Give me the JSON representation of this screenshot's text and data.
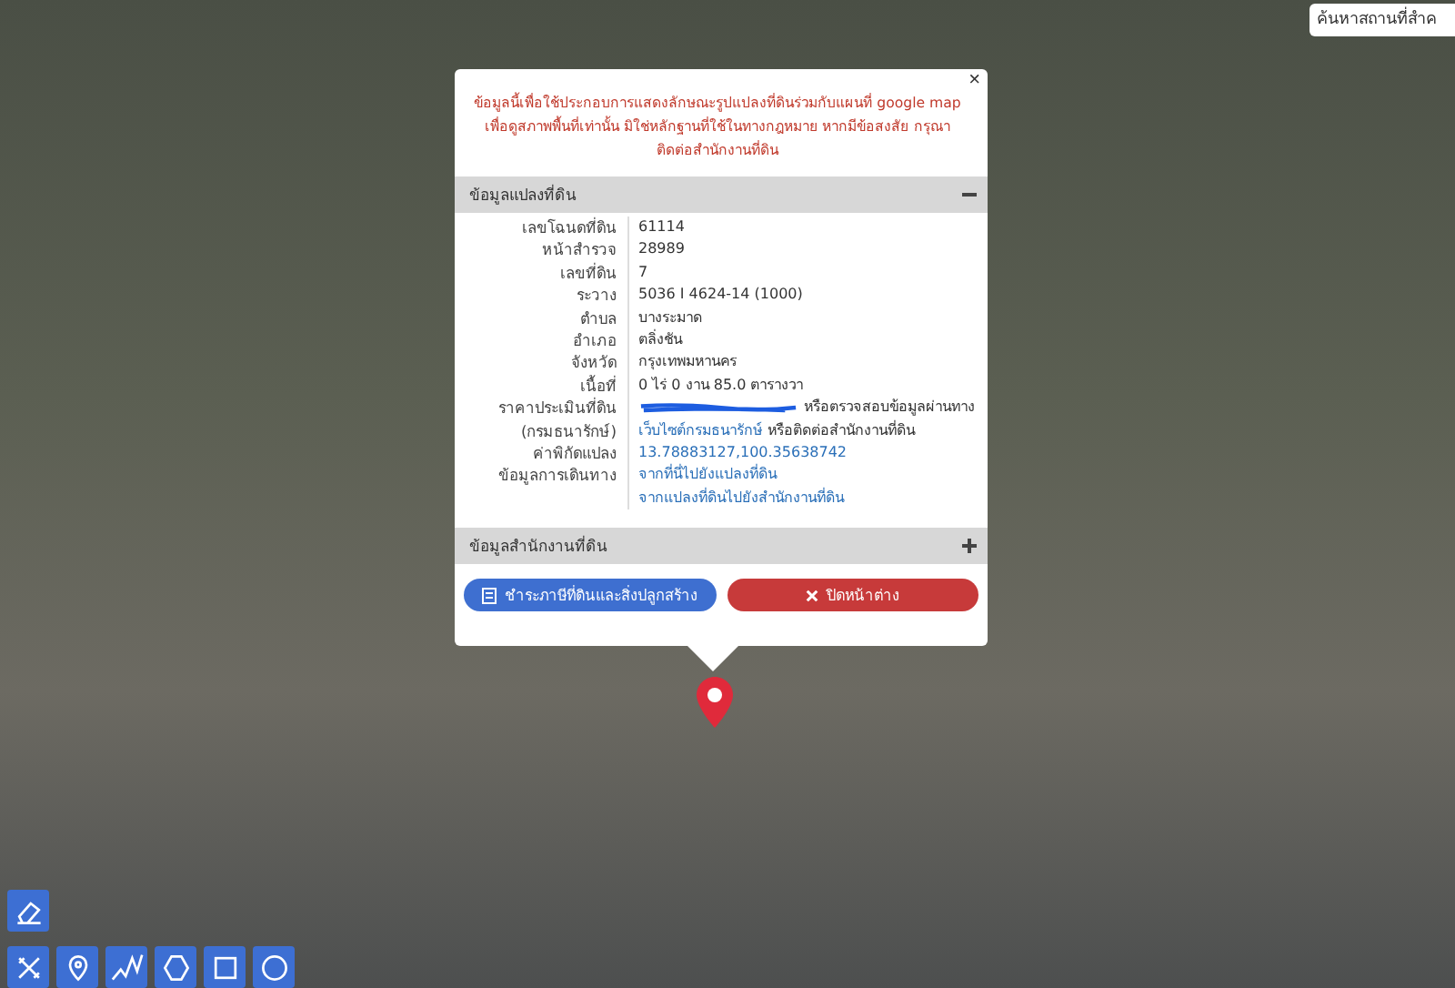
{
  "search": {
    "placeholder": "ค้นหาสถานที่สำค"
  },
  "popup": {
    "close": "×",
    "notice": "ข้อมูลนี้เพื่อใช้ประกอบการแสดงลักษณะรูปแปลงที่ดินร่วมกับแผนที่ google map เพื่อดูสภาพพื้นที่เท่านั้น มิใช่หลักฐานที่ใช้ในทางกฎหมาย หากมีข้อสงสัย กรุณาติดต่อสำนักงานที่ดิน",
    "sections": [
      {
        "title": "ข้อมูลแปลงที่ดิน",
        "expanded": true,
        "rows": [
          {
            "label": "เลขโฉนดที่ดิน",
            "parts": [
              {
                "kind": "text",
                "text": "61114"
              }
            ]
          },
          {
            "label": "หน้าสำรวจ",
            "parts": [
              {
                "kind": "text",
                "text": "28989"
              }
            ]
          },
          {
            "label": "เลขที่ดิน",
            "parts": [
              {
                "kind": "text",
                "text": "7"
              }
            ]
          },
          {
            "label": "ระวาง",
            "parts": [
              {
                "kind": "text",
                "text": "5036 I 4624-14 (1000)"
              }
            ]
          },
          {
            "label": "ตำบล",
            "parts": [
              {
                "kind": "text",
                "text": "บางระมาด"
              }
            ]
          },
          {
            "label": "อำเภอ",
            "parts": [
              {
                "kind": "text",
                "text": "ตลิ่งชัน"
              }
            ]
          },
          {
            "label": "จังหวัด",
            "parts": [
              {
                "kind": "text",
                "text": "กรุงเทพมหานคร"
              }
            ]
          },
          {
            "label": "เนื้อที่",
            "parts": [
              {
                "kind": "text",
                "text": "0 ไร่ 0 งาน 85.0 ตารางวา"
              }
            ]
          },
          {
            "label": "ราคาประเมินที่ดิน",
            "parts": [
              {
                "kind": "redacted"
              },
              {
                "kind": "text",
                "text": "หรือตรวจสอบข้อมูลผ่านทาง"
              }
            ]
          },
          {
            "label": "(กรมธนารักษ์)",
            "parts": [
              {
                "kind": "link",
                "text": "เว็บไซต์กรมธนารักษ์"
              },
              {
                "kind": "text",
                "text": "หรือติดต่อสำนักงานที่ดิน"
              }
            ]
          },
          {
            "label": "ค่าพิกัดแปลง",
            "parts": [
              {
                "kind": "link",
                "text": "13.78883127,100.35638742"
              }
            ]
          },
          {
            "label": "ข้อมูลการเดินทาง",
            "parts": [
              {
                "kind": "link",
                "text": "จากที่นี่ไปยังแปลงที่ดิน"
              }
            ]
          },
          {
            "parts": [
              {
                "kind": "link",
                "text": "จากแปลงที่ดินไปยังสำนักงานที่ดิน"
              }
            ]
          }
        ]
      },
      {
        "title": "ข้อมูลสำนักงานที่ดิน",
        "expanded": false
      }
    ],
    "buttons": [
      {
        "label": "ชำระภาษีที่ดินและสิ่งปลูกสร้าง",
        "kind": "primary"
      },
      {
        "label": "ปิดหน้าต่าง",
        "kind": "danger"
      }
    ]
  },
  "tools": [
    {
      "kind": "eraser"
    },
    {
      "kind": "ruler"
    },
    {
      "kind": "pin"
    },
    {
      "kind": "line"
    },
    {
      "kind": "polygon"
    },
    {
      "kind": "rectangle"
    },
    {
      "kind": "circle"
    }
  ]
}
